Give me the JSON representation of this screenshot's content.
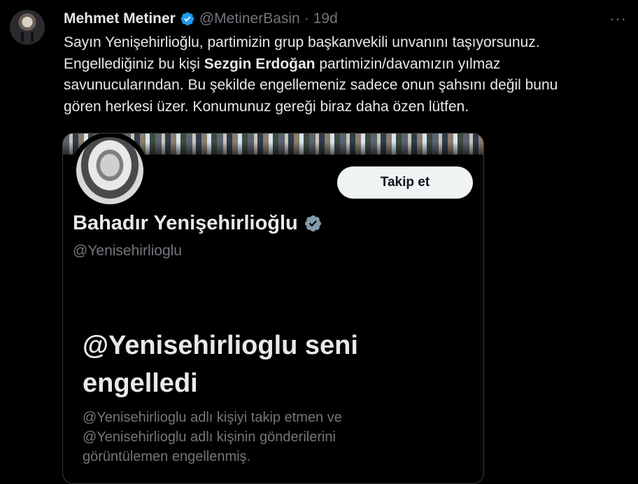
{
  "tweet": {
    "author_name": "Mehmet Metiner",
    "author_handle": "@MetinerBasin",
    "separator": "·",
    "time": "19d",
    "more_label": "···",
    "text_line1": "Sayın Yenişehirlioğlu, partimizin grup başkanvekili unvanını taşıyorsunuz.",
    "text_line2_a": "Engellediğiniz bu kişi ",
    "text_line2_bold": "Sezgin Erdoğan",
    "text_line2_b": " partimizin/davamızın yılmaz",
    "text_line3": "savunucularından. Bu şekilde engellemeniz sadece onun şahsını değil bunu",
    "text_line4": "gören herkesi üzer. Konumunuz gereği biraz daha özen lütfen."
  },
  "embedded_profile": {
    "follow_label": "Takip et",
    "name": "Bahadır Yenişehirlioğlu",
    "handle": "@Yenisehirlioglu",
    "blocked_title_line1": "@Yenisehirlioglu seni",
    "blocked_title_line2": "engelledi",
    "blocked_desc_line1": "@Yenisehirlioglu adlı kişiyi takip etmen ve",
    "blocked_desc_line2": "@Yenisehirlioglu adlı kişinin gönderilerini",
    "blocked_desc_line3": "görüntülemen engellenmiş."
  },
  "colors": {
    "background": "#000000",
    "text": "#e7e9ea",
    "muted": "#71767b",
    "verified": "#1d9bf0",
    "verified_gray": "#829aab"
  },
  "icons": {
    "verified": "verified-badge-icon",
    "more": "more-horizontal-icon"
  }
}
